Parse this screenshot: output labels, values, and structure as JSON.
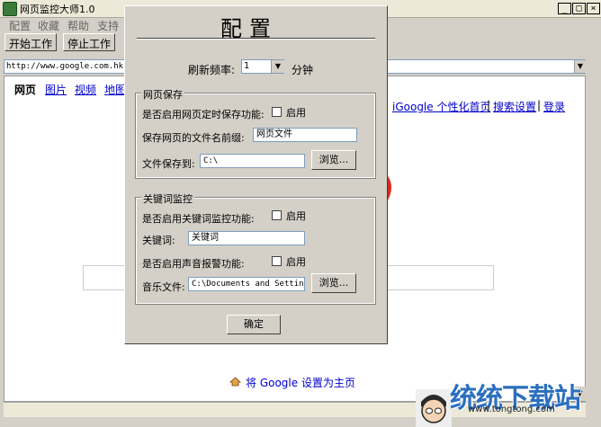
{
  "window": {
    "title": "网页监控大师1.0",
    "minimize": "_",
    "maximize": "□",
    "close": "×"
  },
  "menubar": [
    "配置",
    "收藏",
    "帮助",
    "支持"
  ],
  "toolbar": {
    "start_label": "开始工作",
    "stop_label": "停止工作"
  },
  "address": {
    "url": "http://www.google.com.hk"
  },
  "browser": {
    "nav": [
      "网页",
      "图片",
      "视频",
      "地图"
    ],
    "top_links": [
      "iGoogle 个性化首页",
      "搜索设置",
      "登录"
    ],
    "separator": "|",
    "homepage_link": "将 Google 设置为主页"
  },
  "dialog": {
    "title": "配置",
    "refresh_label": "刷新频率:",
    "refresh_value": "1",
    "refresh_unit": "分钟",
    "save_group": {
      "title": "网页保存",
      "enable_label": "是否启用网页定时保存功能:",
      "enable_checkbox_label": "启用",
      "prefix_label": "保存网页的文件名前缀:",
      "prefix_value": "网页文件",
      "path_label": "文件保存到:",
      "path_value": "C:\\",
      "browse_label": "浏览..."
    },
    "keyword_group": {
      "title": "关键词监控",
      "enable_label": "是否启用关键词监控功能:",
      "enable_checkbox_label": "启用",
      "keyword_label": "关键词:",
      "keyword_value": "关键词",
      "sound_enable_label": "是否启用声音报警功能:",
      "sound_checkbox_label": "启用",
      "music_label": "音乐文件:",
      "music_value": "C:\\Documents and Settin",
      "browse_label": "浏览..."
    },
    "ok_label": "确定"
  },
  "watermark": {
    "text": "统统下载站",
    "url": "www.tongtong.com"
  },
  "colors": {
    "dialog_bg": "#d4d0c8",
    "link": "#0000cc",
    "watermark": "#2b6fbf"
  }
}
